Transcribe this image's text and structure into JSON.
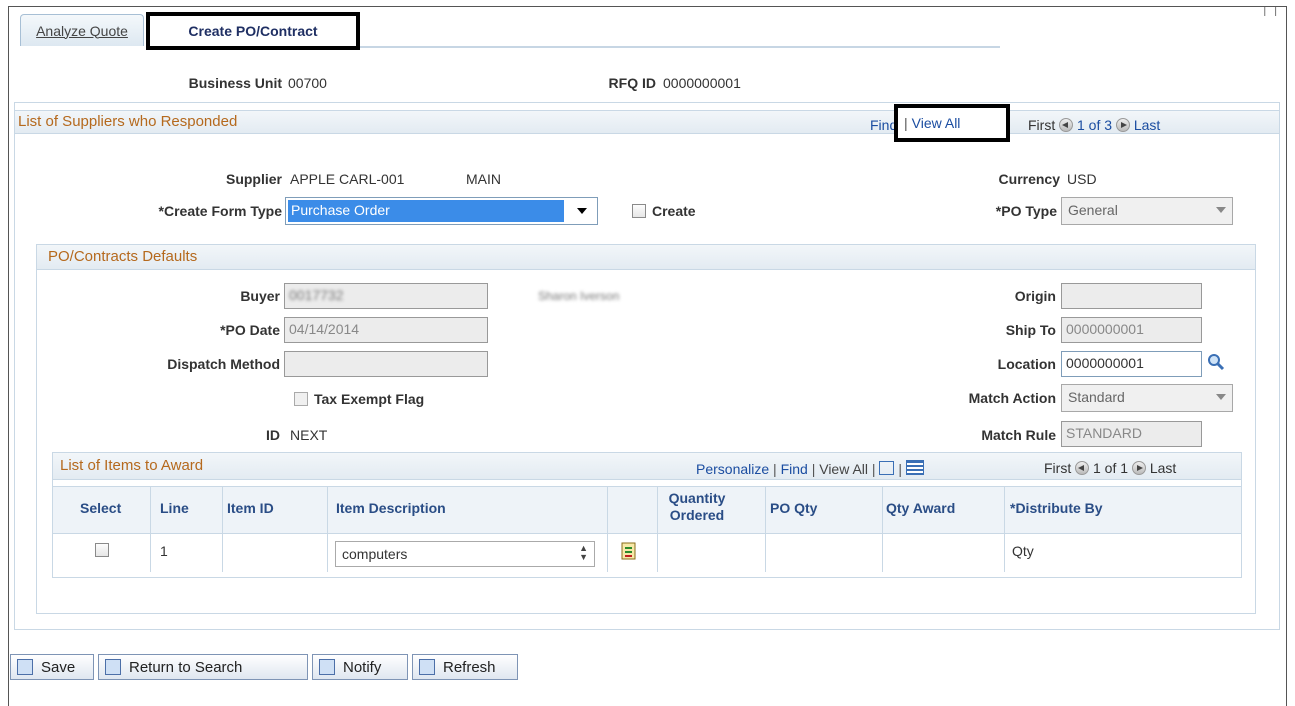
{
  "tabs": [
    {
      "label": "Analyze Quote"
    },
    {
      "label": "Create PO/Contract"
    }
  ],
  "header": {
    "business_unit_label": "Business Unit",
    "business_unit_value": "00700",
    "rfq_id_label": "RFQ ID",
    "rfq_id_value": "0000000001"
  },
  "suppliers_section": {
    "title": "List of Suppliers who Responded",
    "find": "Find",
    "view_all": "View All",
    "first": "First",
    "page_info": "1 of 3",
    "last": "Last"
  },
  "supplier": {
    "label": "Supplier",
    "id": "APPLE CARL-001",
    "location": "MAIN",
    "currency_label": "Currency",
    "currency_value": "USD",
    "create_form_type_label": "*Create Form Type",
    "create_form_type_value": "Purchase Order",
    "create_checkbox_label": "Create",
    "po_type_label": "*PO Type",
    "po_type_value": "General"
  },
  "defaults": {
    "title": "PO/Contracts Defaults",
    "buyer_label": "Buyer",
    "buyer_value": "0017732",
    "buyer_name": "Sharon Iverson",
    "po_date_label": "*PO Date",
    "po_date_value": "04/14/2014",
    "dispatch_label": "Dispatch Method",
    "dispatch_value": "",
    "tax_exempt_label": "Tax Exempt Flag",
    "id_label": "ID",
    "id_value": "NEXT",
    "origin_label": "Origin",
    "origin_value": "",
    "ship_to_label": "Ship To",
    "ship_to_value": "0000000001",
    "location_label": "Location",
    "location_value": "0000000001",
    "match_action_label": "Match Action",
    "match_action_value": "Standard",
    "match_rule_label": "Match Rule",
    "match_rule_value": "STANDARD"
  },
  "items": {
    "title": "List of Items to Award",
    "personalize": "Personalize",
    "find": "Find",
    "view_all": "View All",
    "first": "First",
    "page_info": "1 of 1",
    "last": "Last",
    "columns": [
      "Select",
      "Line",
      "Item ID",
      "Item Description",
      "Quantity Ordered",
      "PO Qty",
      "Qty Award",
      "*Distribute By"
    ],
    "rows": [
      {
        "line": "1",
        "item_id": "",
        "description": "computers",
        "qty_ordered": "",
        "po_qty": "",
        "qty_award": "",
        "distribute_by": "Qty"
      }
    ]
  },
  "footer": {
    "save": "Save",
    "return": "Return to Search",
    "notify": "Notify",
    "refresh": "Refresh"
  }
}
